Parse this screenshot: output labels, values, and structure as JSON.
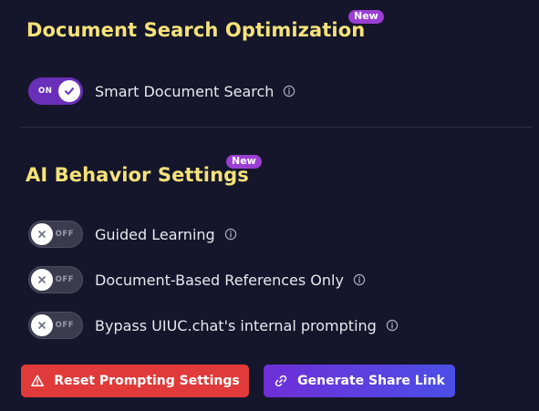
{
  "document_search": {
    "title": "Document Search Optimization",
    "badge": "New",
    "settings": [
      {
        "label": "Smart Document Search",
        "state": "ON",
        "enabled": true
      }
    ]
  },
  "ai_behavior": {
    "title": "AI Behavior Settings",
    "badge": "New",
    "settings": [
      {
        "label": "Guided Learning",
        "state": "OFF",
        "enabled": false
      },
      {
        "label": "Document-Based References Only",
        "state": "OFF",
        "enabled": false
      },
      {
        "label": "Bypass UIUC.chat's internal prompting",
        "state": "OFF",
        "enabled": false
      }
    ]
  },
  "actions": {
    "reset_label": "Reset Prompting Settings",
    "share_label": "Generate Share Link"
  },
  "icons": {
    "info": "info-icon",
    "check": "check-icon",
    "close": "close-icon",
    "warning": "warning-icon",
    "link": "link-icon"
  },
  "colors": {
    "background": "#15162b",
    "title": "#f5e27a",
    "badge": "#9b3fd3",
    "toggle_on": "#6a2fb8",
    "toggle_off": "#3a3c4e",
    "reset_button": "#e03a3a",
    "share_button_start": "#6f2fd8",
    "share_button_end": "#4b4fe6"
  }
}
